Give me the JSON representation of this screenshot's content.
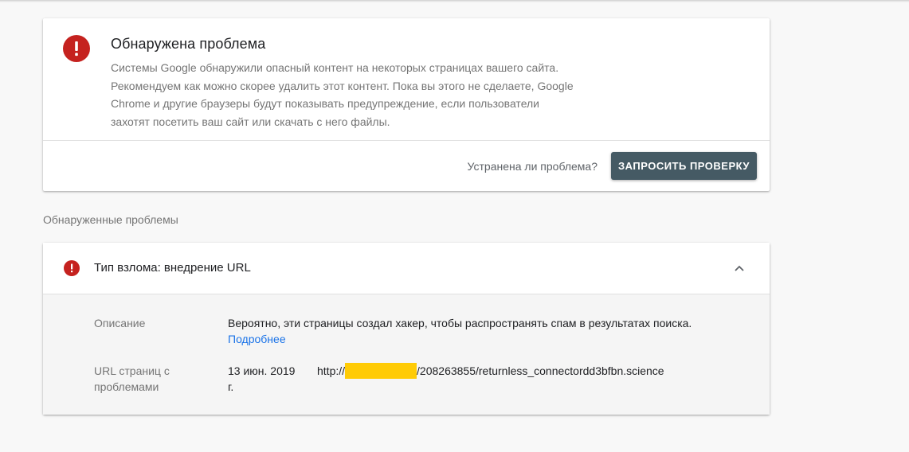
{
  "alert": {
    "title": "Обнаружена проблема",
    "description": "Системы Google обнаружили опасный контент на некоторых страницах вашего сайта. Рекомендуем как можно скорее удалить этот контент. Пока вы этого не сделаете, Google Chrome и другие браузеры будут показывать предупреждение, если пользователи захотят посетить ваш сайт или скачать с него файлы.",
    "fixed_question": "Устранена ли проблема?",
    "validate_button": "ЗАПРОСИТЬ ПРОВЕРКУ",
    "icon": "error-icon",
    "icon_color": "#c5221f",
    "button_color": "#455a64"
  },
  "issues": {
    "section_label": "Обнаруженные проблемы",
    "items": [
      {
        "title": "Тип взлома: внедрение URL",
        "icon": "error-icon",
        "expanded": true,
        "description_label": "Описание",
        "description_text": "Вероятно, эти страницы создал хакер, чтобы распространять спам в результатах поиска.",
        "learn_more": "Подробнее",
        "urls_label": "URL страниц с проблемами",
        "urls": [
          {
            "date": "13 июн. 2019 г.",
            "url_prefix": "http://",
            "url_suffix": "/208263855/returnless_connectordd3bfbn.science"
          }
        ]
      }
    ]
  },
  "colors": {
    "link": "#1a73e8",
    "redaction": "#ffcb05"
  }
}
